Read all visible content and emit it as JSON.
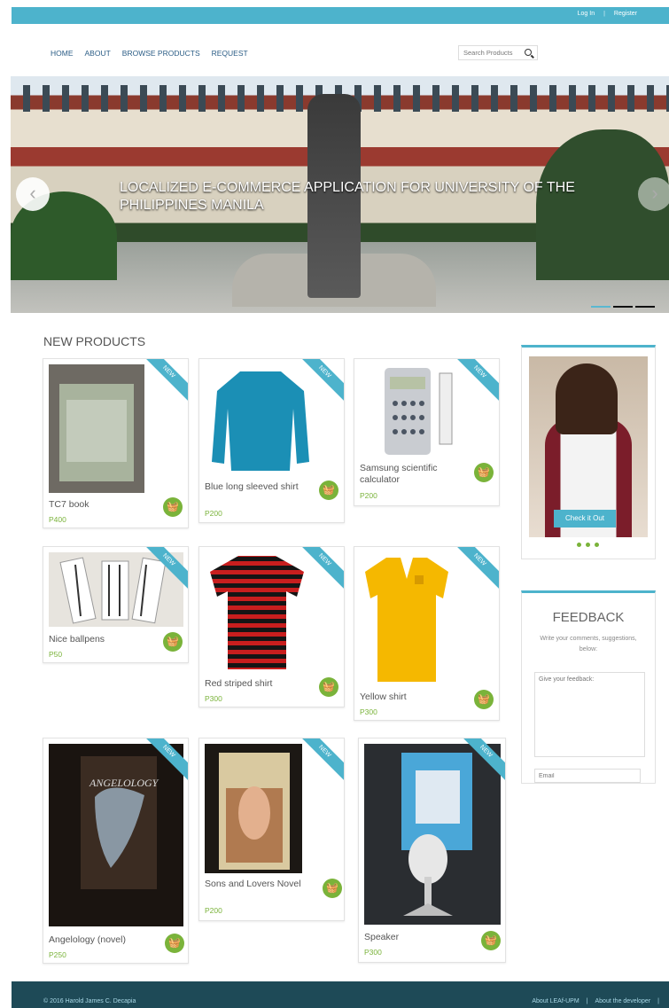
{
  "topbar": {
    "login": "Log In",
    "separator": "|",
    "register": "Register"
  },
  "nav": {
    "items": [
      "HOME",
      "ABOUT",
      "BROWSE PRODUCTS",
      "REQUEST"
    ]
  },
  "search": {
    "placeholder": "Search Products"
  },
  "hero": {
    "caption": "LOCALIZED E-COMMERCE APPLICATION FOR UNIVERSITY OF THE PHILIPPINES MANILA",
    "prev": "‹",
    "next": "›"
  },
  "section_title": "NEW PRODUCTS",
  "ribbon_label": "NEW",
  "products": [
    {
      "name": "TC7 book",
      "price": "P400"
    },
    {
      "name": "Blue long sleeved shirt",
      "price": "P200"
    },
    {
      "name": "Samsung scientific calculator",
      "price": "P200"
    },
    {
      "name": "Nice ballpens",
      "price": "P50"
    },
    {
      "name": "Red striped shirt",
      "price": "P300"
    },
    {
      "name": "Yellow shirt",
      "price": "P300"
    },
    {
      "name": "Angelology (novel)",
      "price": "P250"
    },
    {
      "name": "Sons and Lovers Novel",
      "price": "P200"
    },
    {
      "name": "Speaker",
      "price": "P300"
    }
  ],
  "featured": {
    "button": "Check it Out"
  },
  "feedback": {
    "title": "FEEDBACK",
    "subtitle": "Write your comments, suggestions, below:",
    "textarea_placeholder": "Give your feedback:",
    "email_placeholder": "Email"
  },
  "footer": {
    "copyright": "© 2016 Harold James C. Decapia",
    "link1": "About LEAf-UPM",
    "link2": "About the developer",
    "separator": "|"
  },
  "colors": {
    "accent": "#4db3cc",
    "price": "#7ab33a",
    "footer": "#1e4a57"
  }
}
